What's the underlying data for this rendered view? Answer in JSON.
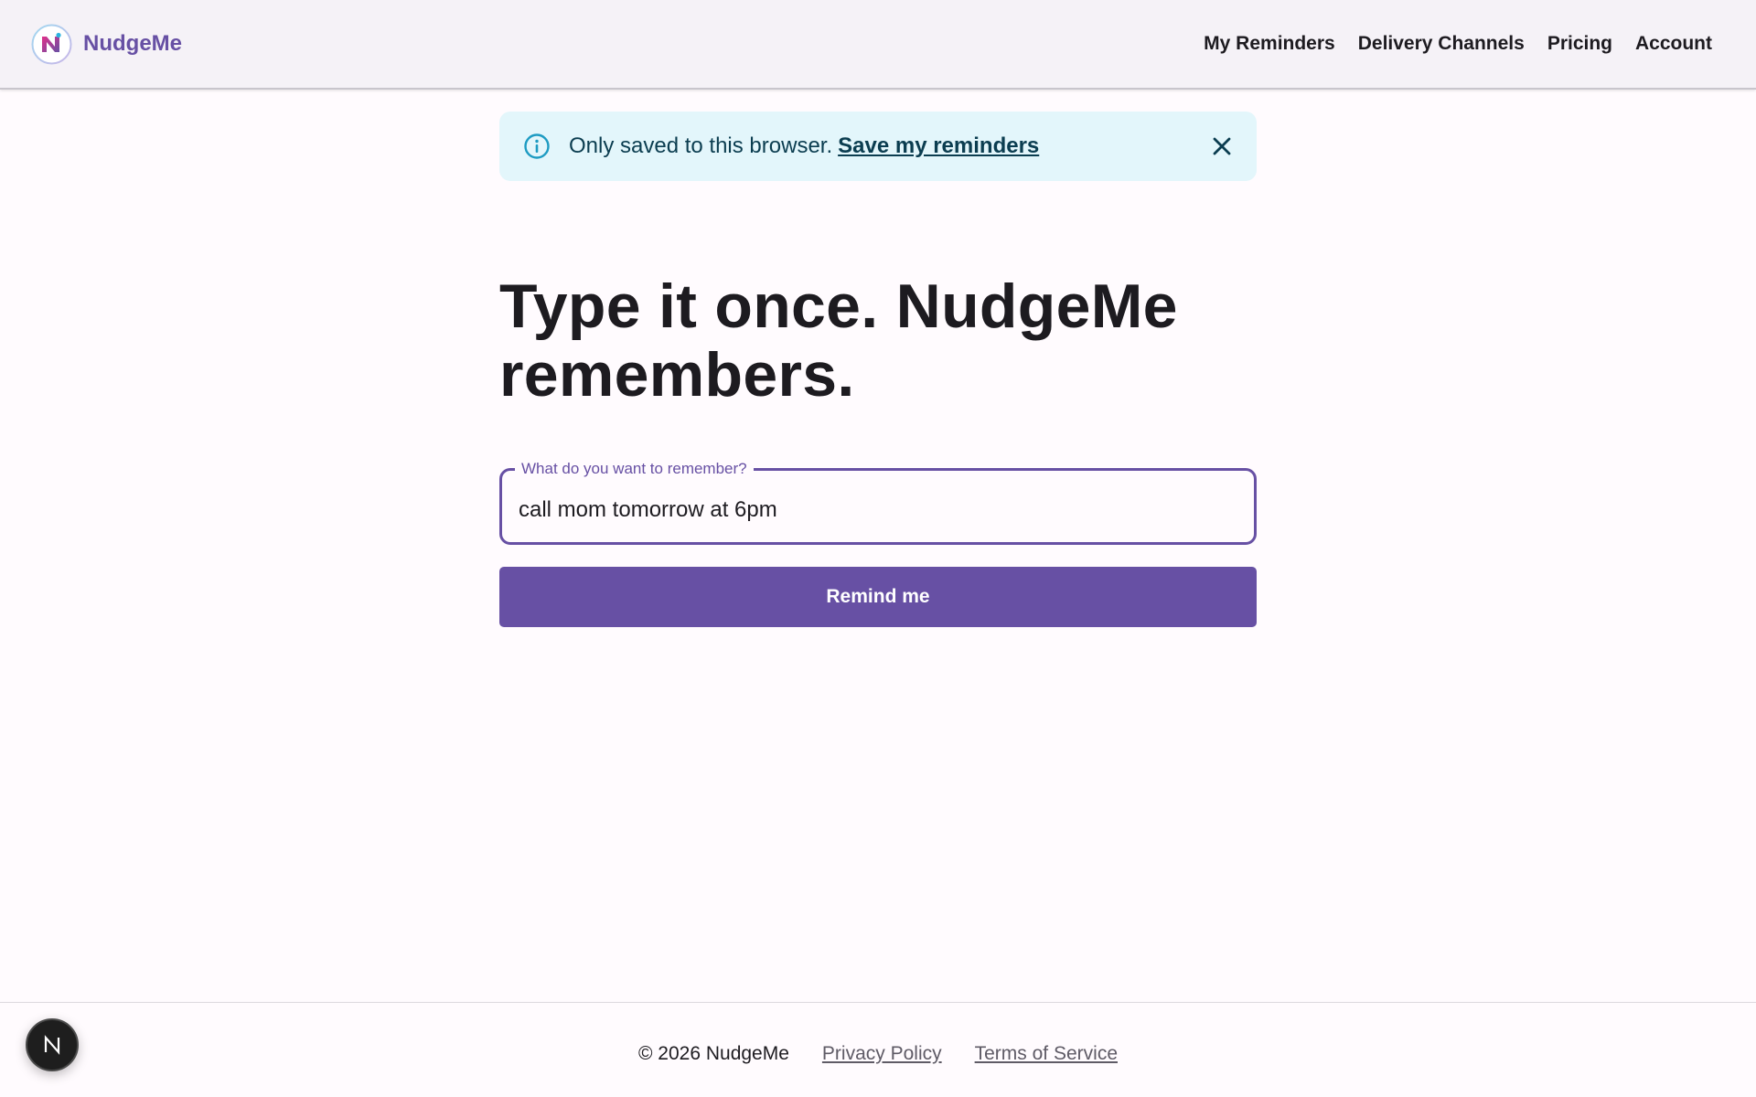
{
  "header": {
    "brand_name": "NudgeMe",
    "nav": [
      {
        "label": "My Reminders"
      },
      {
        "label": "Delivery Channels"
      },
      {
        "label": "Pricing"
      },
      {
        "label": "Account"
      }
    ]
  },
  "banner": {
    "text": "Only saved to this browser.",
    "link_label": "Save my reminders",
    "icon": "info-icon",
    "close_icon": "close-icon"
  },
  "hero": {
    "headline": "Type it once. NudgeMe remembers."
  },
  "reminder_form": {
    "field_label": "What do you want to remember?",
    "value": "call mom tomorrow at 6pm",
    "submit_label": "Remind me"
  },
  "footer": {
    "copyright": "© 2026 NudgeMe",
    "privacy_label": "Privacy Policy",
    "terms_label": "Terms of Service"
  },
  "dev_badge": {
    "icon": "next-logo-icon"
  },
  "colors": {
    "brand": "#6750a4",
    "banner_bg": "#e3f6fb",
    "banner_text": "#0b3d50",
    "info_icon": "#1d9bc2",
    "header_bg": "#f5f2f7",
    "page_bg": "#fffbfe"
  }
}
